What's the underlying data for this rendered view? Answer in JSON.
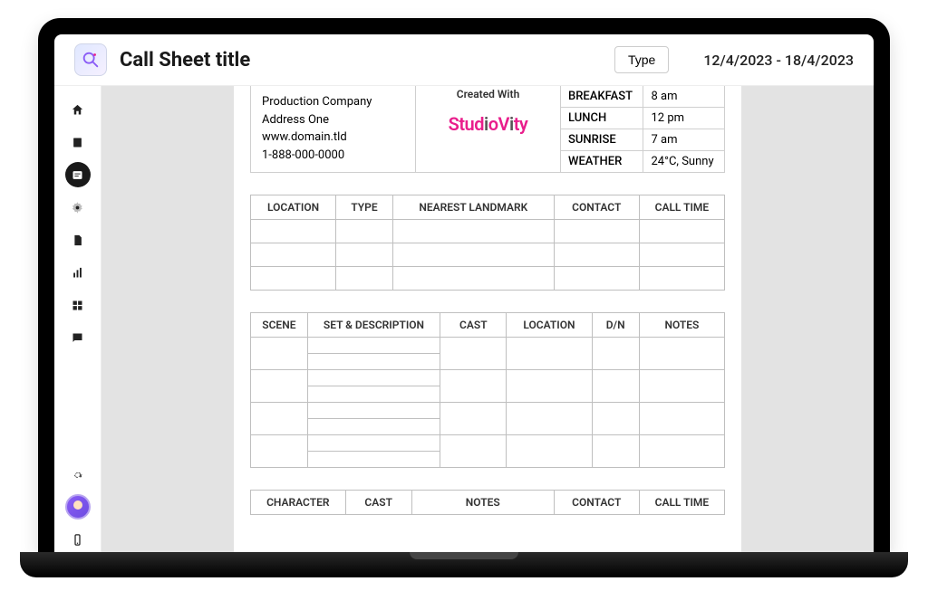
{
  "header": {
    "title": "Call Sheet title",
    "type_button": "Type",
    "date_range": "12/4/2023 - 18/4/2023"
  },
  "production": {
    "company": "Production Company",
    "address": "Address One",
    "website": "www.domain.tld",
    "phone": "1-888-000-0000"
  },
  "created_with": {
    "label": "Created With",
    "brand": "StudioVity"
  },
  "schedule_info": [
    {
      "label": "BREAKFAST",
      "value": "8 am"
    },
    {
      "label": "LUNCH",
      "value": "12 pm"
    },
    {
      "label": "SUNRISE",
      "value": "7 am"
    },
    {
      "label": "WEATHER",
      "value": "24°C, Sunny"
    }
  ],
  "tables": {
    "location_headers": [
      "LOCATION",
      "TYPE",
      "NEAREST LANDMARK",
      "CONTACT",
      "CALL TIME"
    ],
    "scene_headers": [
      "SCENE",
      "SET & DESCRIPTION",
      "CAST",
      "LOCATION",
      "D/N",
      "NOTES"
    ],
    "character_headers": [
      "CHARACTER",
      "CAST",
      "NOTES",
      "CONTACT",
      "CALL TIME"
    ]
  },
  "sidebar": {
    "items": [
      {
        "name": "home-icon"
      },
      {
        "name": "script-icon"
      },
      {
        "name": "callsheet-icon",
        "active": true
      },
      {
        "name": "settings-gear-icon"
      },
      {
        "name": "document-icon"
      },
      {
        "name": "chart-icon"
      },
      {
        "name": "grid-icon"
      },
      {
        "name": "chat-icon"
      }
    ],
    "bottom": [
      {
        "name": "gear-icon"
      },
      {
        "name": "avatar"
      },
      {
        "name": "mobile-icon"
      }
    ]
  }
}
